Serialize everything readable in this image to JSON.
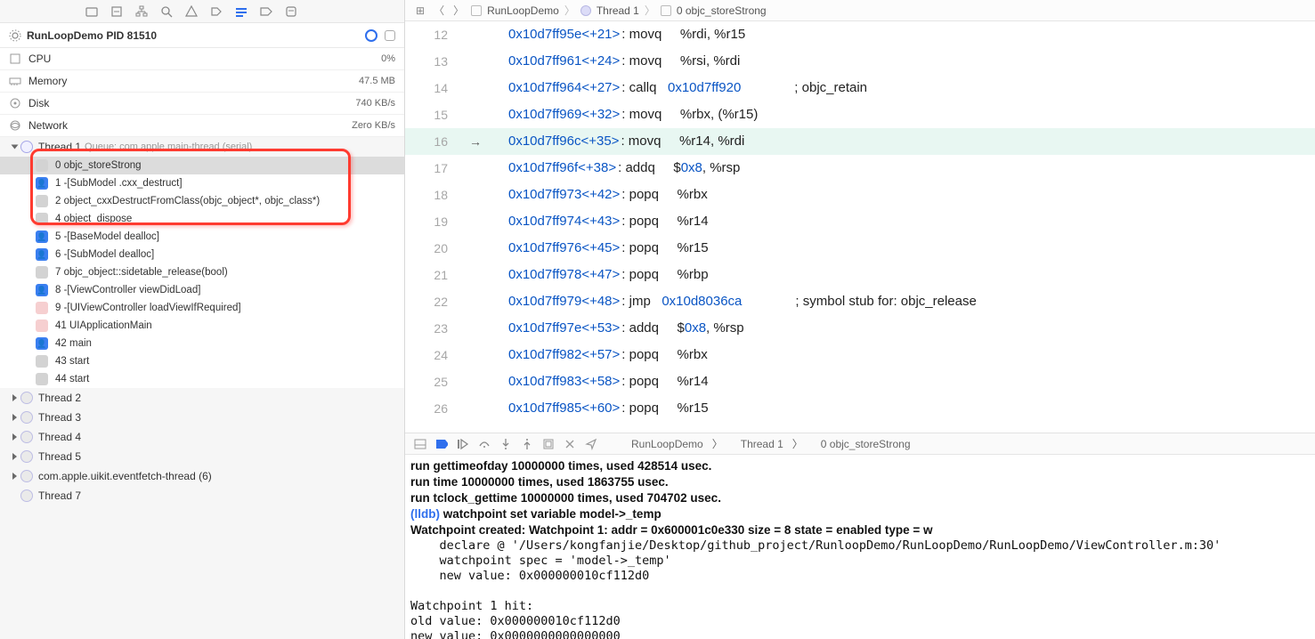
{
  "process": {
    "title": "RunLoopDemo PID 81510"
  },
  "metrics": {
    "cpu": {
      "label": "CPU",
      "value": "0%"
    },
    "memory": {
      "label": "Memory",
      "value": "47.5 MB"
    },
    "disk": {
      "label": "Disk",
      "value": "740 KB/s"
    },
    "network": {
      "label": "Network",
      "value": "Zero KB/s"
    }
  },
  "thread1": {
    "label": "Thread 1",
    "sub": "Queue: com.apple.main-thread (serial)"
  },
  "frames": [
    {
      "n": "0",
      "txt": "objc_storeStrong",
      "icon": "gray",
      "sel": true
    },
    {
      "n": "1",
      "txt": "-[SubModel .cxx_destruct]",
      "icon": "blue"
    },
    {
      "n": "2",
      "txt": "object_cxxDestructFromClass(objc_object*, objc_class*)",
      "icon": "gray"
    },
    {
      "n": "4",
      "txt": "object_dispose",
      "icon": "gray"
    },
    {
      "n": "5",
      "txt": "-[BaseModel dealloc]",
      "icon": "blue"
    },
    {
      "n": "6",
      "txt": "-[SubModel dealloc]",
      "icon": "blue"
    },
    {
      "n": "7",
      "txt": "objc_object::sidetable_release(bool)",
      "icon": "gray"
    },
    {
      "n": "8",
      "txt": "-[ViewController viewDidLoad]",
      "icon": "blue"
    },
    {
      "n": "9",
      "txt": "-[UIViewController loadViewIfRequired]",
      "icon": "pink"
    },
    {
      "n": "41",
      "txt": "UIApplicationMain",
      "icon": "pink"
    },
    {
      "n": "42",
      "txt": "main",
      "icon": "blue"
    },
    {
      "n": "43",
      "txt": "start",
      "icon": "gray"
    },
    {
      "n": "44",
      "txt": "start",
      "icon": "gray"
    }
  ],
  "threads_rest": [
    {
      "label": "Thread 2",
      "expand": true
    },
    {
      "label": "Thread 3",
      "expand": true
    },
    {
      "label": "Thread 4",
      "expand": true
    },
    {
      "label": "Thread 5",
      "expand": true
    },
    {
      "label": "com.apple.uikit.eventfetch-thread (6)",
      "expand": true
    },
    {
      "label": "Thread 7",
      "expand": false
    }
  ],
  "crumbs": {
    "a": "RunLoopDemo",
    "b": "Thread 1",
    "c": "0 objc_storeStrong"
  },
  "asm": [
    {
      "ln": "12",
      "addr": "0x10d7ff95e",
      "off": "<+21>",
      "op": ": movq",
      "arg": "%rdi, %r15"
    },
    {
      "ln": "13",
      "addr": "0x10d7ff961",
      "off": "<+24>",
      "op": ": movq",
      "arg": "%rsi, %rdi"
    },
    {
      "ln": "14",
      "addr": "0x10d7ff964",
      "off": "<+27>",
      "op": ": callq",
      "call": "0x10d7ff920",
      "cmt": "; objc_retain"
    },
    {
      "ln": "15",
      "addr": "0x10d7ff969",
      "off": "<+32>",
      "op": ": movq",
      "arg": "%rbx, (%r15)"
    },
    {
      "ln": "16",
      "addr": "0x10d7ff96c",
      "off": "<+35>",
      "op": ": movq",
      "arg": "%r14, %rdi",
      "cur": true
    },
    {
      "ln": "17",
      "addr": "0x10d7ff96f",
      "off": "<+38>",
      "op": ": addq",
      "pre": "$",
      "num": "0x8",
      "post": ", %rsp"
    },
    {
      "ln": "18",
      "addr": "0x10d7ff973",
      "off": "<+42>",
      "op": ": popq",
      "arg": "%rbx"
    },
    {
      "ln": "19",
      "addr": "0x10d7ff974",
      "off": "<+43>",
      "op": ": popq",
      "arg": "%r14"
    },
    {
      "ln": "20",
      "addr": "0x10d7ff976",
      "off": "<+45>",
      "op": ": popq",
      "arg": "%r15"
    },
    {
      "ln": "21",
      "addr": "0x10d7ff978",
      "off": "<+47>",
      "op": ": popq",
      "arg": "%rbp"
    },
    {
      "ln": "22",
      "addr": "0x10d7ff979",
      "off": "<+48>",
      "op": ": jmp",
      "call": "0x10d8036ca",
      "cmt": "; symbol stub for: objc_release"
    },
    {
      "ln": "23",
      "addr": "0x10d7ff97e",
      "off": "<+53>",
      "op": ": addq",
      "pre": "$",
      "num": "0x8",
      "post": ", %rsp"
    },
    {
      "ln": "24",
      "addr": "0x10d7ff982",
      "off": "<+57>",
      "op": ": popq",
      "arg": "%rbx"
    },
    {
      "ln": "25",
      "addr": "0x10d7ff983",
      "off": "<+58>",
      "op": ": popq",
      "arg": "%r14"
    },
    {
      "ln": "26",
      "addr": "0x10d7ff985",
      "off": "<+60>",
      "op": ": popq",
      "arg": "%r15"
    }
  ],
  "console": {
    "l1": "run gettimeofday 10000000 times, used 428514 usec.",
    "l2": "run time 10000000 times, used 1863755 usec.",
    "l3": "run tclock_gettime 10000000 times, used 704702 usec.",
    "lldb": "(lldb) ",
    "cmd": "watchpoint set variable model->_temp",
    "l5": "Watchpoint created: Watchpoint 1: addr = 0x600001c0e330 size = 8 state = enabled type = w",
    "l6": "    declare @ '/Users/kongfanjie/Desktop/github_project/RunloopDemo/RunLoopDemo/RunLoopDemo/ViewController.m:30'",
    "l7": "    watchpoint spec = 'model->_temp'",
    "l8": "    new value: 0x000000010cf112d0",
    "l9": "",
    "l10": "Watchpoint 1 hit:",
    "l11": "old value: 0x000000010cf112d0",
    "l12": "new value: 0x0000000000000000"
  },
  "dbg_crumbs": {
    "a": "RunLoopDemo",
    "b": "Thread 1",
    "c": "0 objc_storeStrong"
  }
}
